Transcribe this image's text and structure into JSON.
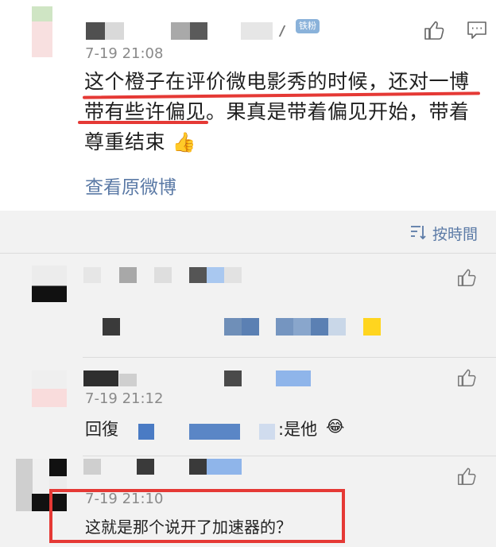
{
  "post": {
    "fan_badge": "铁粉",
    "timestamp": "7-19 21:08",
    "text_line1": "这个橙子在评价微电影秀的时候，还对一博",
    "text_line2": "带有些许偏见。果真是带着偏见开始，带着",
    "text_line3": "尊重结束",
    "emoji": "👍",
    "view_original": "查看原微博"
  },
  "replies_header": {
    "sort_label": "按時間"
  },
  "replies": [
    {
      "timestamp": ""
    },
    {
      "timestamp": "7-19 21:12",
      "reply_prefix": "回復",
      "reply_suffix": ":是他",
      "emoji": "😂"
    },
    {
      "timestamp": "7-19 21:10",
      "text": "这就是那个说开了加速器的？"
    }
  ],
  "colors": {
    "link": "#5b7aa6",
    "highlight_red": "#e53935",
    "reply_bg": "#f2f2f2"
  }
}
